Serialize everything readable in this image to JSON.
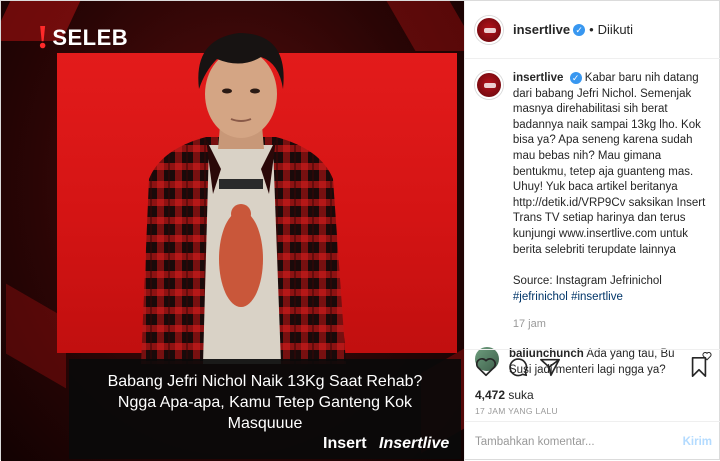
{
  "image": {
    "badge_mark": "!",
    "badge_text": "SELEB",
    "caption": "Babang Jefri Nichol Naik 13Kg Saat Rehab? Ngga Apa-apa, Kamu Tetep Ganteng Kok Masquuue",
    "brand_insert": "Insert",
    "brand_insertlive": "Insertlive",
    "colors": {
      "panel_red": "#e31b1b",
      "caption_bg": "#0a0a0a"
    }
  },
  "header": {
    "username": "insertlive",
    "verified_icon": "verified-badge-icon",
    "dot": "•",
    "follow_status": "Diikuti"
  },
  "post": {
    "username": "insertlive",
    "caption": "Kabar baru nih datang dari babang Jefri Nichol. Semenjak masnya direhabilitasi sih berat badannya naik sampai 13kg lho. Kok bisa ya? Apa seneng karena sudah mau bebas nih? Mau gimana bentukmu, tetep aja guanteng mas. Uhuy! Yuk baca artikel beritanya http://detik.id/VRP9Cv saksikan Insert Trans TV setiap harinya dan terus kunjungi www.insertlive.com untuk berita selebriti terupdate lainnya",
    "source": "Source: Instagram Jefrinichol",
    "tag1": "#jefrinichol",
    "tag2": "#insertlive",
    "time": "17 jam"
  },
  "comment": {
    "username": "baliunchunch",
    "text": "Ada yang tau, Bu Susi jadi menteri lagi ngga ya?",
    "like_icon": "heart-outline-icon"
  },
  "actions": {
    "likes_count": "4,472",
    "likes_label": "suka",
    "date": "17 JAM YANG LALU"
  },
  "add_comment": {
    "placeholder": "Tambahkan komentar...",
    "submit": "Kirim"
  }
}
